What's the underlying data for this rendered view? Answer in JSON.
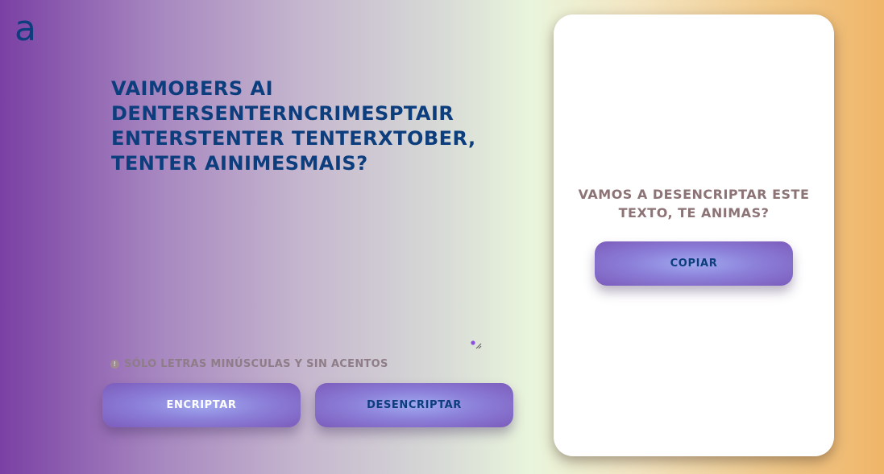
{
  "logo": {
    "text": "a"
  },
  "input": {
    "text": "vaimobers ai dentersenterncrimesptair enterstenter tenterxtober, tenter ainimesmais?"
  },
  "hint": {
    "icon": "info-icon",
    "icon_glyph": "!",
    "text": "Sólo letras minúsculas y sin acentos"
  },
  "buttons": {
    "encrypt_label": "Encriptar",
    "decrypt_label": "Desencriptar"
  },
  "output_panel": {
    "message": "Vamos a desencriptar este texto, te animas?",
    "copy_label": "Copiar"
  },
  "colors": {
    "primary_text": "#0c3d7d",
    "panel_text": "#8c7376",
    "hint_text": "#8e7d88",
    "button_gradient": [
      "#a0a8ef",
      "#8c80d9",
      "#7c5bbb"
    ],
    "background_gradient": [
      "#7a40a4",
      "#d7dad6",
      "#e9f5dc",
      "#efb569"
    ]
  }
}
